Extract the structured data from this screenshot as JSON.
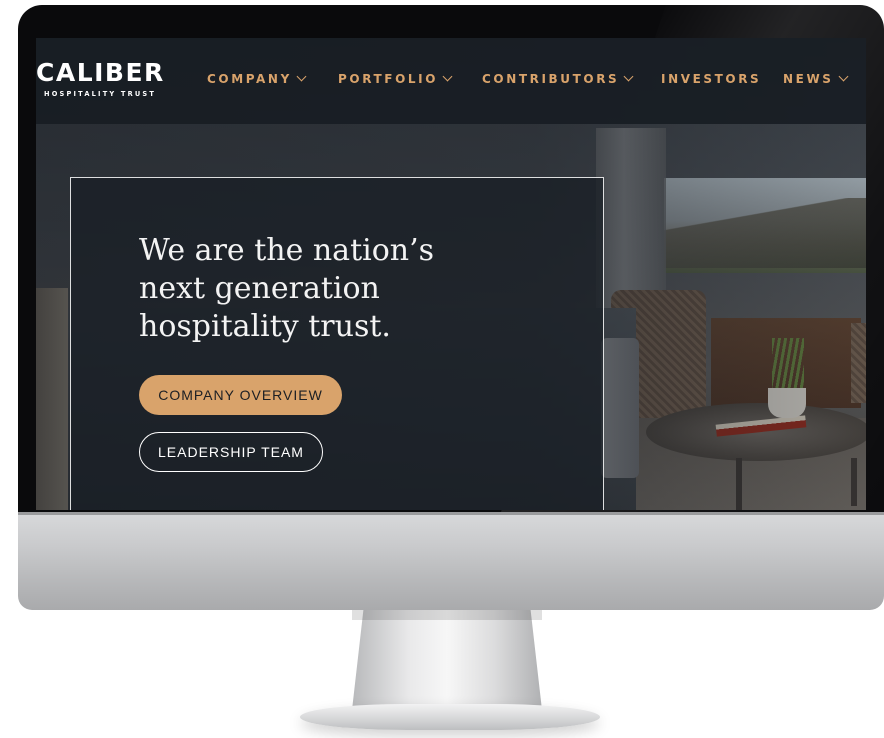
{
  "brand": {
    "name": "CALIBER",
    "tagline": "HOSPITALITY TRUST"
  },
  "nav": {
    "items": [
      {
        "label": "COMPANY",
        "has_dropdown": true
      },
      {
        "label": "PORTFOLIO",
        "has_dropdown": true
      },
      {
        "label": "CONTRIBUTORS",
        "has_dropdown": true
      },
      {
        "label": "INVESTORS",
        "has_dropdown": false
      },
      {
        "label": "NEWS",
        "has_dropdown": true
      }
    ]
  },
  "hero": {
    "headline_lines": [
      "We are the nation’s",
      "next generation",
      "hospitality trust."
    ],
    "primary_button": "COMPANY OVERVIEW",
    "secondary_button": "LEADERSHIP TEAM"
  },
  "colors": {
    "accent": "#d9a36b",
    "nav_background": "#181d24",
    "text_light": "#ffffff"
  },
  "icons": [
    "chevron-down-icon"
  ]
}
